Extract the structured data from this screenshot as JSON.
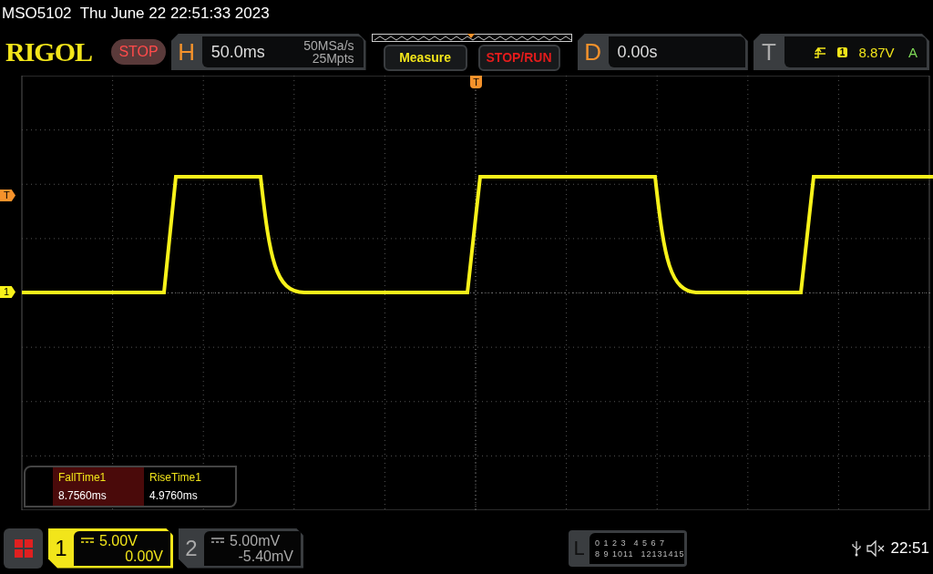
{
  "status_line": "MSO5102  Thu June 22 22:51:33 2023",
  "logo": "RIGOL",
  "run_state": {
    "label": "STOP",
    "kind": "stop"
  },
  "horizontal": {
    "letter": "H",
    "scale": "50.0ms",
    "sample_rate": "50MSa/s",
    "memory_depth": "25Mpts"
  },
  "buttons": [
    {
      "label": "Measure",
      "kind": "measure"
    },
    {
      "label": "STOP/RUN",
      "kind": "run"
    }
  ],
  "delay": {
    "letter": "D",
    "value": "0.00s"
  },
  "trigger": {
    "letter": "T",
    "source": "1",
    "level": "8.87V",
    "mode": "A"
  },
  "markers": {
    "trigger_position": "T",
    "trigger_level": "T",
    "channel": "1"
  },
  "measurements": [
    {
      "name": "FallTime1",
      "value": "8.7560ms",
      "selected": true
    },
    {
      "name": "RiseTime1",
      "value": "4.9760ms",
      "selected": false
    }
  ],
  "channels": [
    {
      "number": "1",
      "scale": "5.00V",
      "offset": "0.00V",
      "selected": true
    },
    {
      "number": "2",
      "scale": "5.00mV",
      "offset": "-5.40mV",
      "selected": false
    }
  ],
  "logic": {
    "letter": "L",
    "rows": [
      [
        "0 1 2 3",
        "4 5 6 7"
      ],
      [
        "8 9 1011",
        "12131415"
      ]
    ]
  },
  "clock": "22:51"
}
